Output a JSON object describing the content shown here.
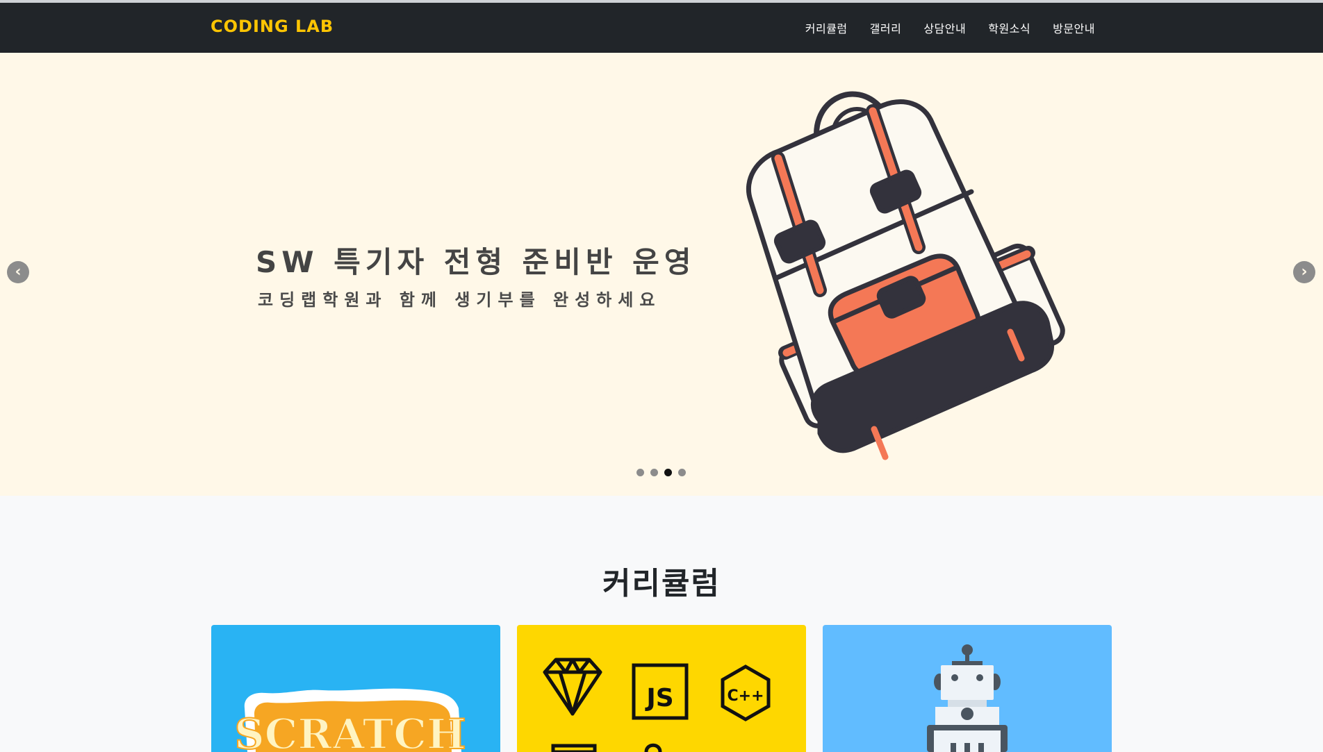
{
  "brand": "CODING LAB",
  "nav": {
    "items": [
      "커리큘럼",
      "갤러리",
      "상담안내",
      "학원소식",
      "방문안내"
    ]
  },
  "hero": {
    "title": "SW 특기자 전형 준비반 운영",
    "subtitle": "코딩랩학원과 함께 생기부를 완성하세요",
    "prev_icon": "chevron-left-icon",
    "next_icon": "chevron-right-icon",
    "slides_total": 4,
    "active_slide": 3,
    "illustration": "backpack-illustration"
  },
  "colors": {
    "navbar": "#212529",
    "brand": "#fec503",
    "hero_bg": "#fff8e8",
    "card_scratch": "#29b3f3",
    "card_code": "#fed700",
    "card_robot": "#61bcff"
  },
  "section": {
    "title": "커리큘럼"
  },
  "cards": {
    "scratch_logo": "SCRATCH",
    "code_icons": [
      "diamond-icon",
      "js-icon",
      "cpp-icon"
    ],
    "js_label": "JS",
    "cpp_label": "C++",
    "robot_icon": "robot-icon"
  }
}
